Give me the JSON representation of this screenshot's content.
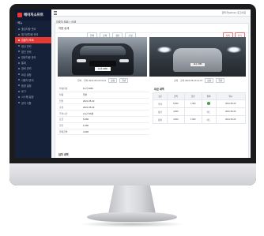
{
  "app": {
    "logo_text": "에이치소프트",
    "top_user": "관리자(admin) 로그아웃"
  },
  "sidebar": {
    "header": "메뉴",
    "items": [
      {
        "label": "출입차량 관리"
      },
      {
        "label": "정기권차량 관리"
      },
      {
        "label": "입출차 조회"
      },
      {
        "label": "정산 관리"
      },
      {
        "label": "할인 관리"
      },
      {
        "label": "방문차량 관리"
      },
      {
        "label": "통계"
      },
      {
        "label": "장비 관리"
      },
      {
        "label": "요금 설정"
      },
      {
        "label": "사용자 관리"
      },
      {
        "label": "환경 설정"
      },
      {
        "label": "로그"
      },
      {
        "label": "시스템 설정"
      },
      {
        "label": "공지 사항"
      }
    ],
    "active_index": 2
  },
  "main": {
    "breadcrumb": "입출차 조회 > 상세",
    "panel_title": "차량 상세",
    "buttons": [
      "입차",
      "출차",
      "정산",
      "수정"
    ],
    "right_buttons": [
      "삭제",
      "닫기"
    ],
    "cam_left": {
      "label": "입차",
      "plate": "12가 3456",
      "info": "입차 2021-05-20 10:21",
      "tags": [
        "정상",
        "일반"
      ]
    },
    "cam_right": {
      "label": "출차",
      "plate": "12가 3456",
      "info": "출차 2021-05-20 12:47",
      "tags": [
        "정상",
        "일반"
      ]
    },
    "details": [
      {
        "k": "차량번호",
        "v": "12가 3456"
      },
      {
        "k": "차종",
        "v": "일반"
      },
      {
        "k": "입차",
        "v": "2021-05-20"
      },
      {
        "k": "출차",
        "v": "2021-05-20"
      },
      {
        "k": "주차시간",
        "v": "2시간 26분"
      },
      {
        "k": "요금",
        "v": "5,000"
      },
      {
        "k": "할인",
        "v": "1,000"
      },
      {
        "k": "결제금액",
        "v": "4,000"
      }
    ],
    "payment_title": "요금 내역",
    "payment_cols": [
      "구분",
      "금액",
      "할인",
      "결제",
      "일시"
    ],
    "payment_rows": [
      [
        "주차",
        "5,000",
        "1,000",
        "",
        "2021-05-20"
      ],
      [
        "정산",
        "4,000",
        "",
        "카드",
        "2021-05-20"
      ],
      [
        "합계",
        "4,000",
        "1,000",
        "카드",
        "2021-05-20"
      ]
    ],
    "bottom_title": "입차 내역"
  }
}
